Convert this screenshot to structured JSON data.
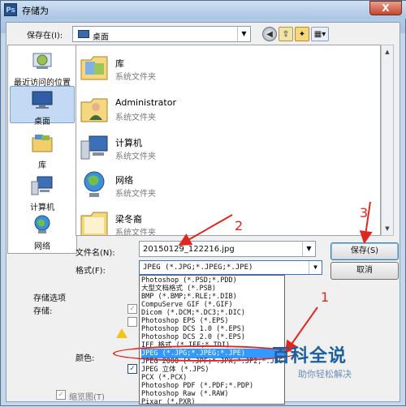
{
  "window": {
    "title": "存储为",
    "app_icon": "Ps",
    "close_icon": "X"
  },
  "toolbar": {
    "save_in_label": "保存在(I):",
    "location": "桌面"
  },
  "places": [
    {
      "label": "最近访问的位置",
      "icon": "recent-places-icon"
    },
    {
      "label": "桌面",
      "icon": "desktop-icon",
      "selected": true
    },
    {
      "label": "库",
      "icon": "libraries-icon"
    },
    {
      "label": "计算机",
      "icon": "computer-icon"
    },
    {
      "label": "网络",
      "icon": "network-icon"
    }
  ],
  "files": [
    {
      "name": "库",
      "type": "系统文件夹",
      "icon": "libraries-folder-icon"
    },
    {
      "name": "Administrator",
      "type": "系统文件夹",
      "icon": "user-folder-icon"
    },
    {
      "name": "计算机",
      "type": "系统文件夹",
      "icon": "computer-icon"
    },
    {
      "name": "网络",
      "type": "系统文件夹",
      "icon": "network-icon"
    },
    {
      "name": "梁冬裔",
      "type": "系统文件夹",
      "icon": "folder-icon"
    }
  ],
  "form": {
    "filename_label": "文件名(N):",
    "filename_value": "20150129_122216.jpg",
    "format_label": "格式(F):",
    "format_value": "JPEG (*.JPG;*.JPEG;*.JPE)",
    "save_button": "保存(S)",
    "cancel_button": "取消"
  },
  "options": {
    "title": "存储选项",
    "store_label": "存储:",
    "color_label": "颜色:",
    "thumbnail_label": "缩览图(T)"
  },
  "format_options": [
    "Photoshop (*.PSD;*.PDD)",
    "大型文档格式 (*.PSB)",
    "BMP (*.BMP;*.RLE;*.DIB)",
    "CompuServe GIF (*.GIF)",
    "Dicom (*.DCM;*.DC3;*.DIC)",
    "Photoshop EPS (*.EPS)",
    "Photoshop DCS 1.0 (*.EPS)",
    "Photoshop DCS 2.0 (*.EPS)",
    "IFF 格式 (*.IFF;*.TDI)",
    "JPEG (*.JPG;*.JPEG;*.JPE)",
    "JPEG 2000 (*.JPF;*.JPX;*.JP2;*.J2C;*.J2K;*.JPC)",
    "JPEG 立体 (*.JPS)",
    "PCX (*.PCX)",
    "Photoshop PDF (*.PDF;*.PDP)",
    "Photoshop Raw (*.RAW)",
    "Pixar (*.PXR)"
  ],
  "annotations": [
    "1",
    "2",
    "3"
  ],
  "watermark": {
    "logo": "百科全说",
    "tagline": "助你轻松解决"
  }
}
